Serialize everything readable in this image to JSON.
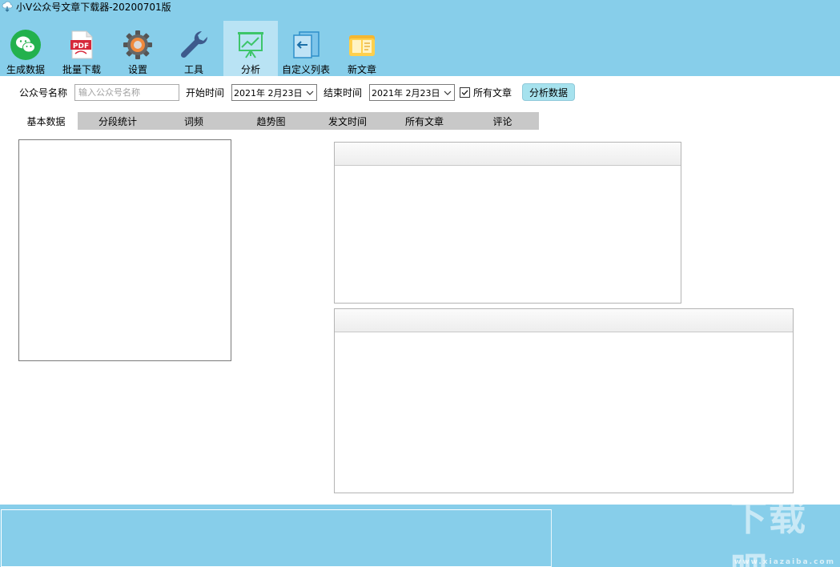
{
  "window": {
    "title": "小V公众号文章下载器-20200701版",
    "app_icon": "cloud-download-icon"
  },
  "toolbar": {
    "buttons": [
      {
        "label": "生成数据",
        "icon": "wechat-icon"
      },
      {
        "label": "批量下载",
        "icon": "pdf-icon"
      },
      {
        "label": "设置",
        "icon": "gear-icon"
      },
      {
        "label": "工具",
        "icon": "wrench-icon"
      },
      {
        "label": "分析",
        "icon": "chart-icon",
        "active": true
      },
      {
        "label": "自定义列表",
        "icon": "import-icon"
      },
      {
        "label": "新文章",
        "icon": "folder-icon"
      }
    ]
  },
  "filter": {
    "account_label": "公众号名称",
    "account_placeholder": "输入公众号名称",
    "account_value": "",
    "start_label": "开始时间",
    "start_value": "2021年  2月23日",
    "end_label": "结束时间",
    "end_value": "2021年  2月23日",
    "all_articles_label": "所有文章",
    "all_articles_checked": true,
    "analyze_button": "分析数据"
  },
  "tabs": [
    {
      "label": "基本数据",
      "active": true
    },
    {
      "label": "分段统计"
    },
    {
      "label": "词频"
    },
    {
      "label": "趋势图"
    },
    {
      "label": "发文时间"
    },
    {
      "label": "所有文章"
    },
    {
      "label": "评论"
    }
  ],
  "watermark": {
    "text": "下载吧",
    "sub": "www.xiazaiba.com"
  },
  "colors": {
    "header_bg": "#87ceea",
    "active_tool_bg": "#b9e3f4",
    "tab_inactive_bg": "#c8c8c8",
    "analyze_button_bg": "#a6e2ee"
  }
}
